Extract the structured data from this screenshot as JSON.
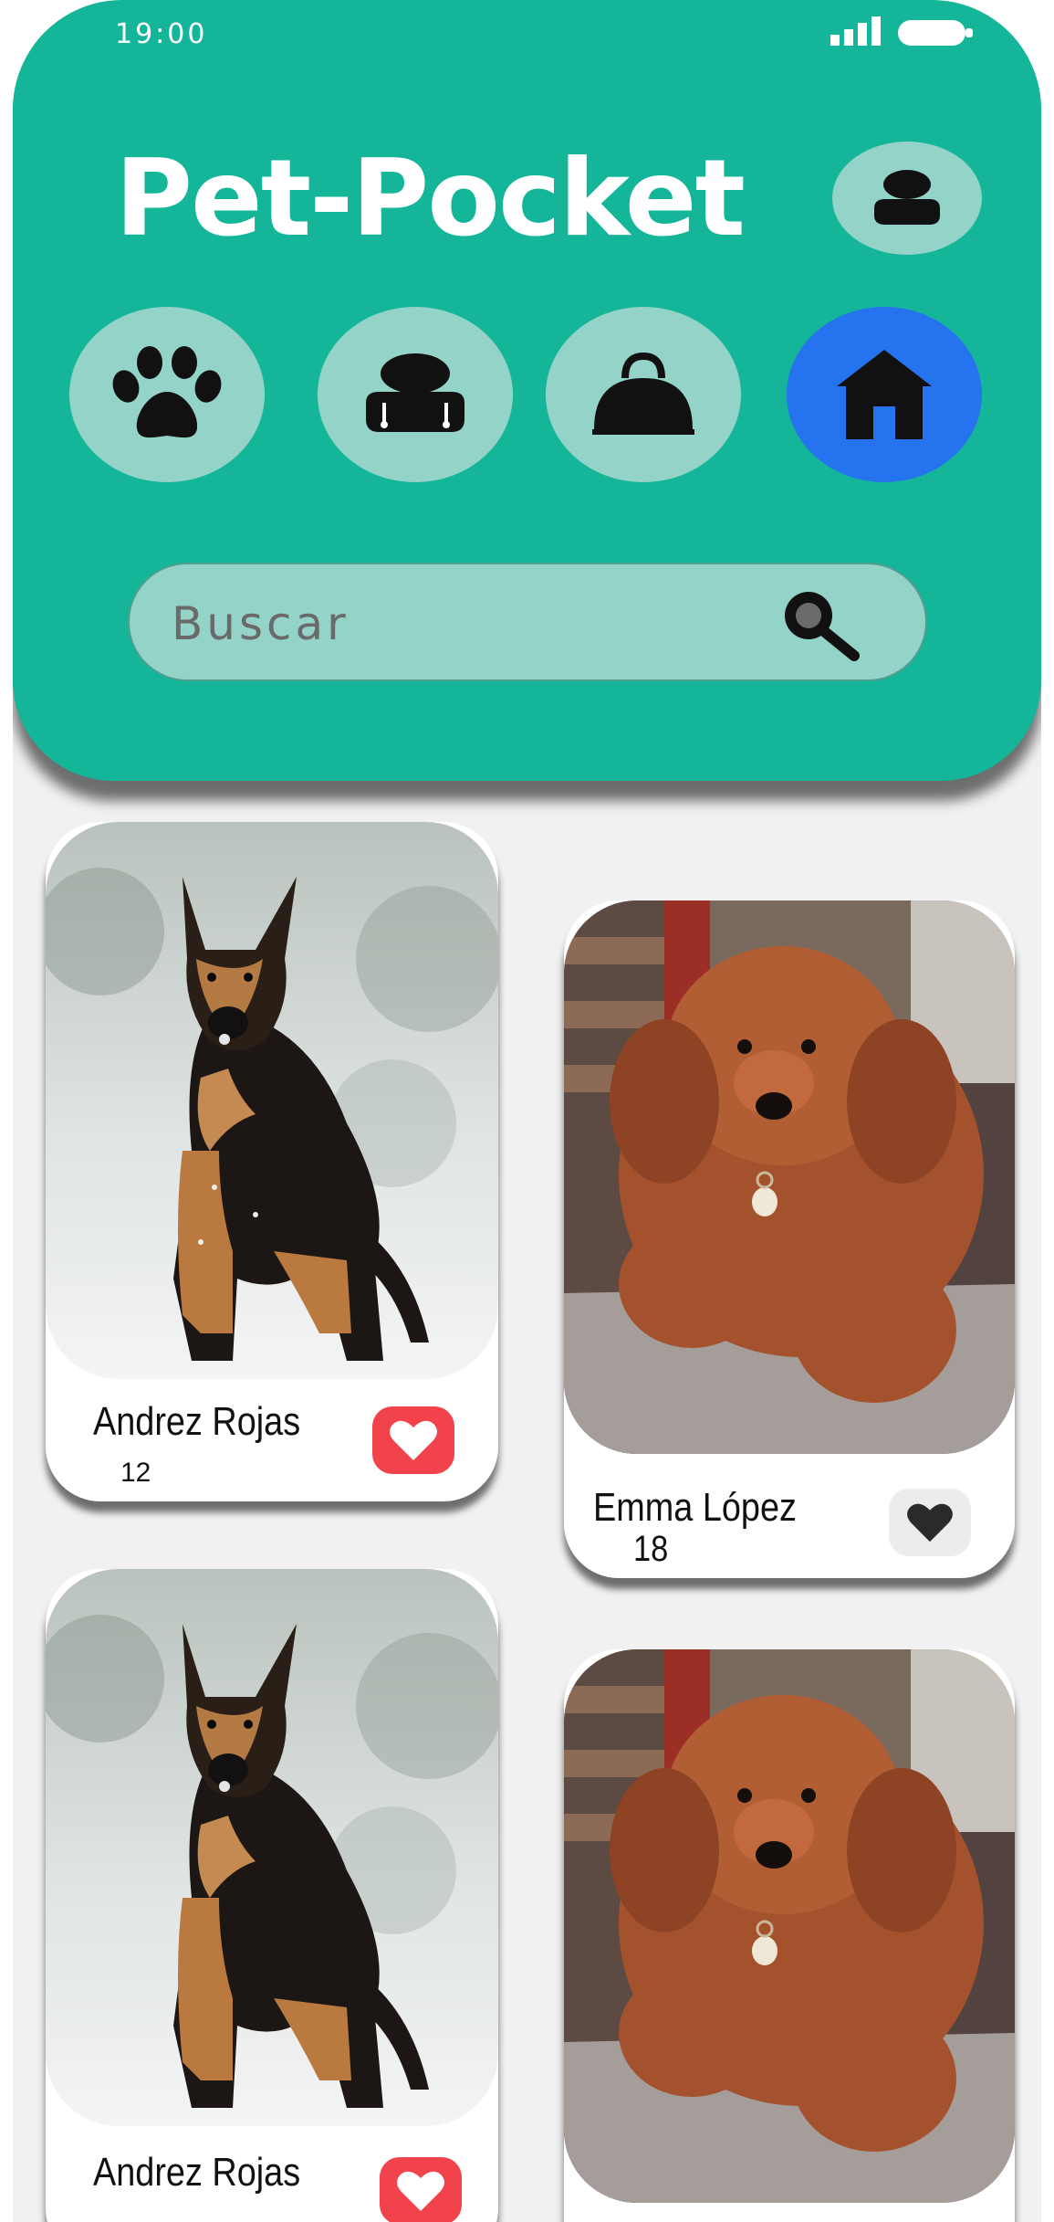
{
  "status_bar": {
    "time": "19:00",
    "icons": [
      "signal-icon",
      "battery-icon"
    ]
  },
  "header": {
    "title": "Pet-Pocket",
    "profile_icon": "user-icon"
  },
  "categories": [
    {
      "icon": "paw-icon",
      "active": false
    },
    {
      "icon": "bed-icon",
      "active": false
    },
    {
      "icon": "carrier-bag-icon",
      "active": false
    },
    {
      "icon": "doghouse-icon",
      "active": true
    }
  ],
  "search": {
    "placeholder": "Buscar",
    "icon": "search-icon"
  },
  "cards": [
    {
      "name": "Andrez Rojas",
      "count": "12",
      "liked": true,
      "image": "german-shepherd-puppy"
    },
    {
      "name": "Emma López",
      "count": "18",
      "liked": false,
      "image": "brown-doodle-puppy"
    },
    {
      "name": "Andrez Rojas",
      "count": "",
      "liked": true,
      "image": "german-shepherd-puppy"
    },
    {
      "name": "",
      "count": "",
      "liked": false,
      "image": "brown-doodle-puppy"
    }
  ],
  "colors": {
    "header": "#15b59a",
    "pill": "#94d3c7",
    "active": "#2673f0",
    "like": "#f2434c",
    "background": "#f1f1f1"
  }
}
